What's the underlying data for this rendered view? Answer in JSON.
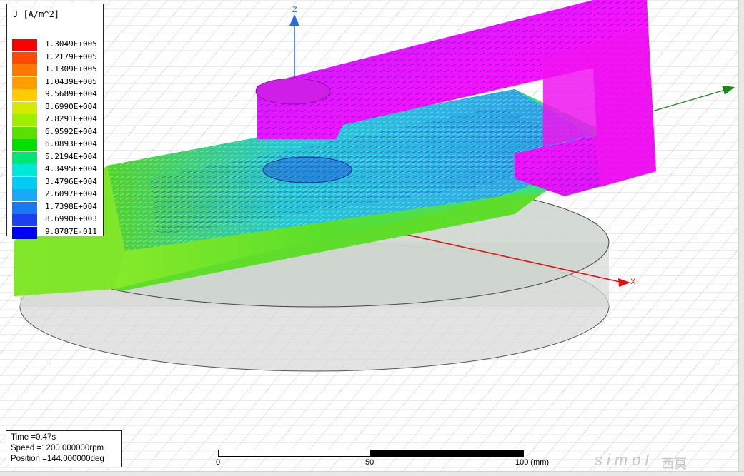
{
  "legend": {
    "title": "J [A/m^2]",
    "entries": [
      {
        "value": "1.3049E+005",
        "color": "#ff0000"
      },
      {
        "value": "1.2179E+005",
        "color": "#ff4a00"
      },
      {
        "value": "1.1309E+005",
        "color": "#ff7800"
      },
      {
        "value": "1.0439E+005",
        "color": "#ff9e00"
      },
      {
        "value": "9.5689E+004",
        "color": "#ffcc00"
      },
      {
        "value": "8.6990E+004",
        "color": "#d4ea00"
      },
      {
        "value": "7.8291E+004",
        "color": "#9ef000"
      },
      {
        "value": "6.9592E+004",
        "color": "#5ae000"
      },
      {
        "value": "6.0893E+004",
        "color": "#00e000"
      },
      {
        "value": "5.2194E+004",
        "color": "#00e676"
      },
      {
        "value": "4.3495E+004",
        "color": "#00e8d8"
      },
      {
        "value": "3.4796E+004",
        "color": "#00ccf4"
      },
      {
        "value": "2.6097E+004",
        "color": "#1aa8f8"
      },
      {
        "value": "1.7398E+004",
        "color": "#1a78f4"
      },
      {
        "value": "8.6990E+003",
        "color": "#1a40f0"
      },
      {
        "value": "9.8787E-011",
        "color": "#0000f0"
      }
    ]
  },
  "status": {
    "time": "Time    =0.47s",
    "speed": "Speed   =1200.000000rpm",
    "position": "Position =144.000000deg"
  },
  "scale": {
    "label_start": "0",
    "label_mid": "50",
    "label_end": "100 (mm)"
  },
  "axes": {
    "x_label": "X",
    "z_label": "Z",
    "x_color": "#e01010",
    "y_color": "#1a8a1a",
    "z_color": "#2a6be0"
  },
  "watermark": {
    "text": "simol",
    "cn": "西莫"
  }
}
